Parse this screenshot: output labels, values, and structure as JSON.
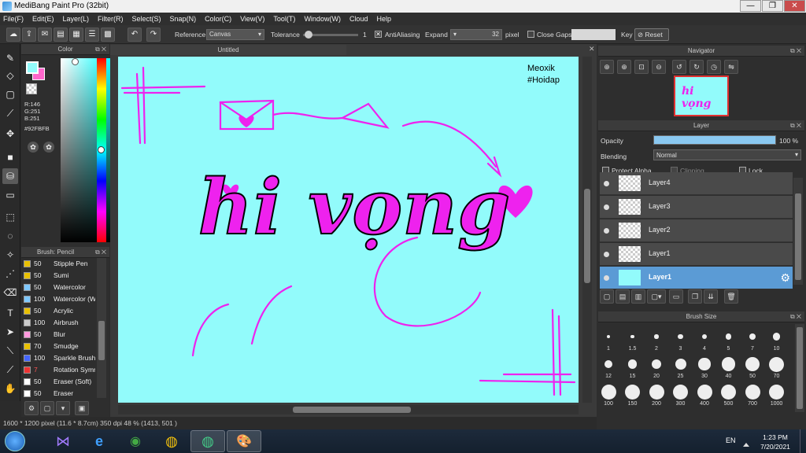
{
  "window": {
    "title": "MediBang Paint Pro (32bit)",
    "btn_min": "—",
    "btn_max": "❐",
    "btn_close": "✕"
  },
  "menu": [
    "File(F)",
    "Edit(E)",
    "Layer(L)",
    "Filter(R)",
    "Select(S)",
    "Snap(N)",
    "Color(C)",
    "View(V)",
    "Tool(T)",
    "Window(W)",
    "Cloud",
    "Help"
  ],
  "toolbar": {
    "reference_label": "Reference",
    "reference_value": "Canvas",
    "tolerance_label": "Tolerance",
    "tolerance_value": "1",
    "tolerance_fraction": 0.03,
    "antialiasing_label": "AntiAliasing",
    "antialiasing_checked": true,
    "expand_label": "Expand",
    "expand_value": "32",
    "expand_unit": "pixel",
    "close_gaps_label": "Close Gaps",
    "close_gaps_checked": false,
    "key_label": "Key",
    "reset_label": "Reset"
  },
  "color_panel": {
    "title": "Color",
    "r": "R:146",
    "g": "G:251",
    "b": "B:251",
    "hex": "#92FBFB",
    "primary_color": "#92fbfb",
    "secondary_color": "#ff66cc"
  },
  "brush_panel": {
    "title": "Brush: Pencil",
    "items": [
      {
        "size": "50",
        "name": "Stipple Pen",
        "color": "#e8c000"
      },
      {
        "size": "50",
        "name": "Sumi",
        "color": "#e8c000"
      },
      {
        "size": "50",
        "name": "Watercolor",
        "color": "#7ec8ff"
      },
      {
        "size": "100",
        "name": "Watercolor (Wet)",
        "color": "#7ec8ff"
      },
      {
        "size": "50",
        "name": "Acrylic",
        "color": "#e8c000"
      },
      {
        "size": "100",
        "name": "Airbrush",
        "color": "#cccccc"
      },
      {
        "size": "50",
        "name": "Blur",
        "color": "#ff99dd"
      },
      {
        "size": "70",
        "name": "Smudge",
        "color": "#e8c000"
      },
      {
        "size": "100",
        "name": "Sparkle Brush",
        "color": "#4466ff"
      },
      {
        "size": "7",
        "name": "Rotation Symmetry",
        "color": "#ee3333"
      },
      {
        "size": "50",
        "name": "Eraser (Soft)",
        "color": "#ffffff"
      },
      {
        "size": "50",
        "name": "Eraser",
        "color": "#ffffff"
      }
    ]
  },
  "canvas": {
    "tab_title": "Untitled",
    "background": "#92fbfb",
    "watermark_1": "Meoxik",
    "watermark_2": "#Hoidap",
    "lettering": "hi vọng",
    "ink_color": "#ee22ee"
  },
  "navigator": {
    "title": "Navigator"
  },
  "layer_panel": {
    "title": "Layer",
    "opacity_label": "Opacity",
    "opacity_value": "100 %",
    "opacity_fraction": 1.0,
    "blending_label": "Blending",
    "blending_value": "Normal",
    "protect_alpha_label": "Protect Alpha",
    "clipping_label": "Clipping",
    "lock_label": "Lock",
    "layers": [
      {
        "name": "Layer4",
        "selected": false
      },
      {
        "name": "Layer3",
        "selected": false
      },
      {
        "name": "Layer2",
        "selected": false
      },
      {
        "name": "Layer1",
        "selected": false
      },
      {
        "name": "Layer1",
        "selected": true
      }
    ]
  },
  "brush_size_panel": {
    "title": "Brush Size",
    "sizes": [
      "1",
      "1.5",
      "2",
      "3",
      "4",
      "5",
      "7",
      "10",
      "12",
      "15",
      "20",
      "25",
      "30",
      "40",
      "50",
      "70",
      "100",
      "150",
      "200",
      "300",
      "400",
      "500",
      "700",
      "1000"
    ]
  },
  "status": {
    "text": "1600 * 1200 pixel  (11.6 * 8.7cm)  350 dpi  48 %  (1413, 501 )"
  },
  "taskbar": {
    "lang": "EN",
    "time": "1:23 PM",
    "date": "7/20/2021"
  }
}
